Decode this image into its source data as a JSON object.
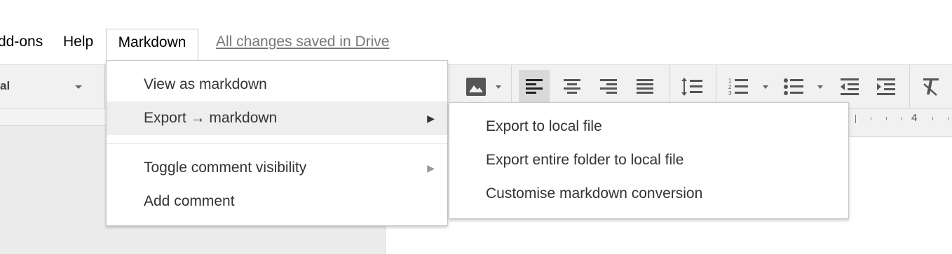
{
  "menubar": {
    "addons_label": "dd-ons",
    "help_label": "Help",
    "markdown_label": "Markdown",
    "save_status": "All changes saved in Drive"
  },
  "toolbar": {
    "font_value": "al",
    "buttons": [
      "image-icon",
      "align-left-icon",
      "align-center-icon",
      "align-right-icon",
      "align-justify-icon",
      "line-spacing-icon",
      "numbered-list-icon",
      "bulleted-list-icon",
      "decrease-indent-icon",
      "increase-indent-icon",
      "clear-formatting-icon"
    ],
    "active_button": "align-left-icon"
  },
  "ruler": {
    "number": "4"
  },
  "dropdown": {
    "items": [
      {
        "label": "View as markdown"
      },
      {
        "label": "Export → markdown",
        "has_submenu": true,
        "highlighted": true
      },
      {
        "label": "Toggle comment visibility",
        "has_submenu": true
      },
      {
        "label": "Add comment"
      }
    ],
    "submenu_arrow": "▶"
  },
  "submenu": {
    "items": [
      {
        "label": "Export to local file"
      },
      {
        "label": "Export entire folder to local file"
      },
      {
        "label": "Customise markdown conversion"
      }
    ]
  },
  "colors": {
    "toolbar_bg": "#f1f1f1",
    "highlight": "#eeeeee",
    "save_status": "#777777"
  }
}
